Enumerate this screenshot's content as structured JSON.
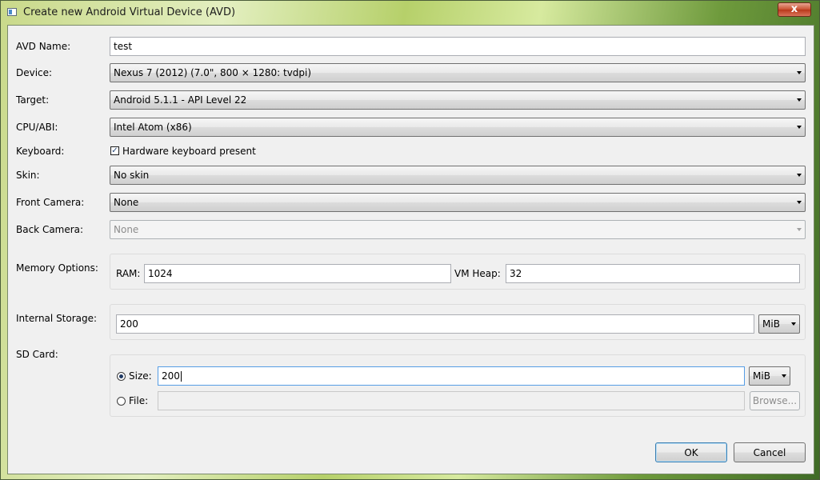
{
  "window": {
    "title": "Create new Android Virtual Device (AVD)",
    "close_label": "x"
  },
  "form": {
    "avd_name": {
      "label": "AVD Name:",
      "value": "test"
    },
    "device": {
      "label": "Device:",
      "value": "Nexus 7 (2012) (7.0\", 800 × 1280: tvdpi)"
    },
    "target": {
      "label": "Target:",
      "value": "Android 5.1.1 - API Level 22"
    },
    "cpu_abi": {
      "label": "CPU/ABI:",
      "value": "Intel Atom (x86)"
    },
    "keyboard": {
      "label": "Keyboard:",
      "checkbox_label": "Hardware keyboard present",
      "checked": true
    },
    "skin": {
      "label": "Skin:",
      "value": "No skin"
    },
    "front_camera": {
      "label": "Front Camera:",
      "value": "None"
    },
    "back_camera": {
      "label": "Back Camera:",
      "value": "None",
      "disabled": true
    },
    "memory": {
      "label": "Memory Options:",
      "ram_label": "RAM:",
      "ram_value": "1024",
      "vm_heap_label": "VM Heap:",
      "vm_heap_value": "32"
    },
    "internal_storage": {
      "label": "Internal Storage:",
      "value": "200",
      "unit": "MiB"
    },
    "sd_card": {
      "label": "SD Card:",
      "size_label": "Size:",
      "size_value": "200",
      "size_unit": "MiB",
      "size_selected": true,
      "file_label": "File:",
      "file_value": "",
      "browse_label": "Browse..."
    }
  },
  "buttons": {
    "ok": "OK",
    "cancel": "Cancel"
  },
  "check_glyph": "✓"
}
